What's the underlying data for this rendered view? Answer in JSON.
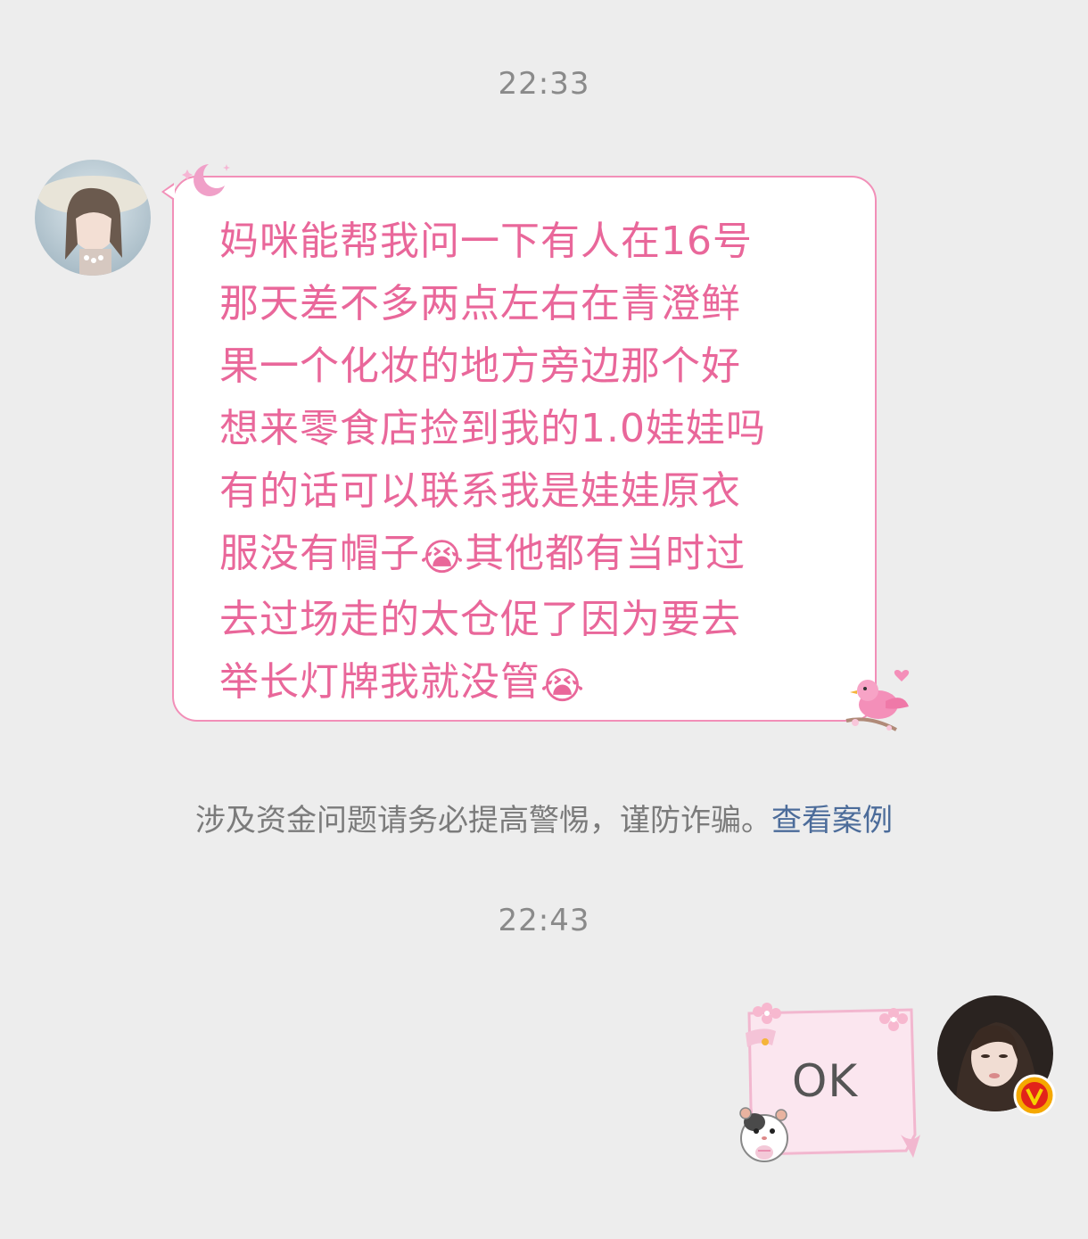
{
  "conversation": {
    "timestamp_1": "22:33",
    "incoming_message": {
      "lines": [
        "妈咪能帮我问一下有人在16号",
        "那天差不多两点左右在青澄鲜",
        "果一个化妆的地方旁边那个好",
        "想来零食店捡到我的1.0娃娃吗",
        "有的话可以联系我是娃娃原衣",
        "服没有帽子"
      ],
      "line6_after_emoji": "其他都有当时过",
      "line7": "去过场走的太仓促了因为要去",
      "line8": "举长灯牌我就没管",
      "emoji": "😭"
    },
    "safety_notice": {
      "text": "涉及资金问题请务必提高警惕，谨防诈骗。",
      "link": "查看案例"
    },
    "timestamp_2": "22:43",
    "outgoing_message": {
      "text": "OK"
    },
    "icons": {
      "left_avatar": "avatar-left",
      "right_avatar": "avatar-right",
      "verified_badge": "verified-v-icon",
      "moon": "moon-icon",
      "bird": "pink-bird-sticker",
      "hamster": "hamster-sticker",
      "flowers": "cherry-blossom-icon"
    },
    "colors": {
      "background": "#ededed",
      "message_text": "#e9679a",
      "bubble_border": "#f28fb8",
      "link": "#4c6c9a",
      "badge": "#f5a800"
    }
  }
}
